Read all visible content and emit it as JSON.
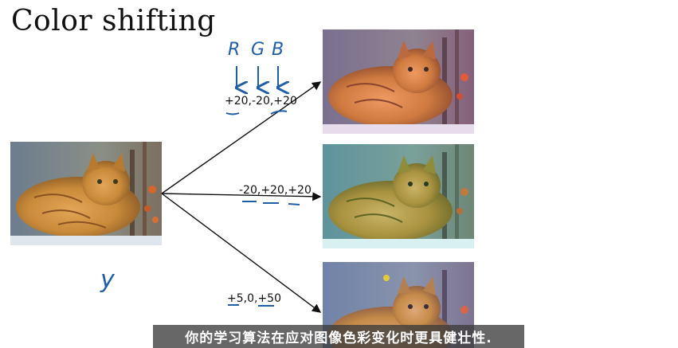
{
  "slide": {
    "title": "Color shifting",
    "rgb_letters": [
      "R",
      "G",
      "B"
    ],
    "shifts": [
      "+20,-20,+20",
      "-20,+20,+20",
      "+5,0,+50"
    ],
    "label_y": "y",
    "subtitle": "你的学习算法在应对图像色彩变化时更具健壮性."
  },
  "colors": {
    "annotation_blue": "#1f5fa8",
    "source_fur": "#c98a3a",
    "shift1_fur": "#cf7a3f",
    "shift2_fur": "#a9923f",
    "shift3_fur": "#c48a48"
  }
}
